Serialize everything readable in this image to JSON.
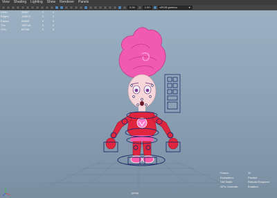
{
  "menu": [
    "View",
    "Shading",
    "Lighting",
    "Show",
    "Renderer",
    "Panels"
  ],
  "toolbar": {
    "field_a": "0.00",
    "field_b": "1.00",
    "color_space": "sRGB gamma"
  },
  "hud_stats": [
    {
      "label": "Verts:",
      "value": "36857",
      "a": "0",
      "b": "0"
    },
    {
      "label": "Edges:",
      "value": "108876",
      "a": "0",
      "b": "0"
    },
    {
      "label": "Faces:",
      "value": "95669",
      "a": "0",
      "b": "0"
    },
    {
      "label": "Tris:",
      "value": "195748",
      "a": "0",
      "b": "0"
    },
    {
      "label": "UVs:",
      "value": "60786",
      "a": "0",
      "b": "0"
    }
  ],
  "hud_eval": [
    {
      "label": "Frame:",
      "value": "11"
    },
    {
      "label": "Evaluation:",
      "value": "Parallel"
    },
    {
      "label": "GM State:",
      "value": "Rebuild Required"
    },
    {
      "label": "GPU Override:",
      "value": "Enabled"
    }
  ],
  "camera_label": "persp",
  "colors": {
    "hair": "#f05ab0",
    "suit": "#e0263f",
    "accent": "#ff78c8",
    "rig": "#1f2d6b"
  }
}
